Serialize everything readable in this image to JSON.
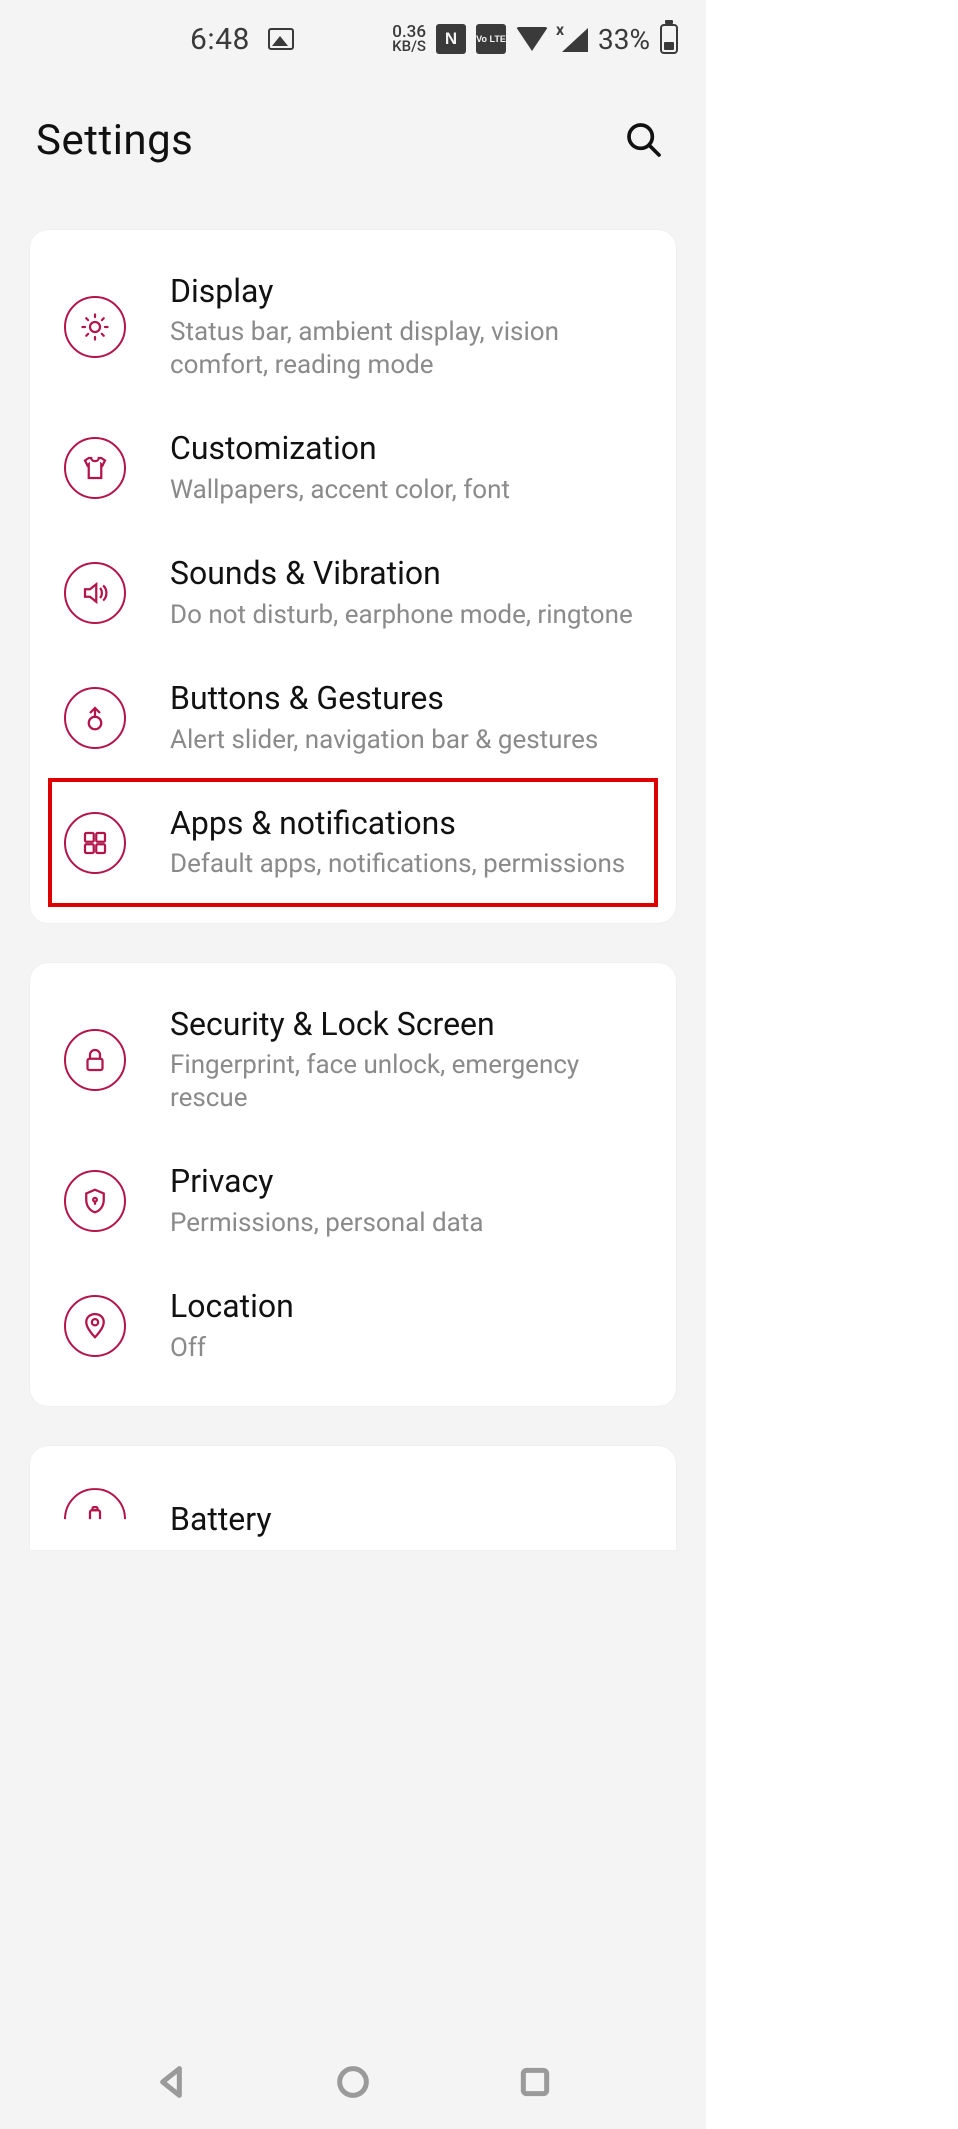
{
  "status": {
    "time": "6:48",
    "net_speed": "0.36",
    "net_unit": "KB/S",
    "nfc": "N",
    "volte": "Vo LTE",
    "sig_x": "x",
    "battery": "33%"
  },
  "header": {
    "title": "Settings"
  },
  "groups": [
    {
      "items": [
        {
          "icon": "brightness",
          "title": "Display",
          "subtitle": "Status bar, ambient display, vision comfort, reading mode",
          "highlighted": false
        },
        {
          "icon": "tshirt",
          "title": "Customization",
          "subtitle": "Wallpapers, accent color, font",
          "highlighted": false
        },
        {
          "icon": "sound",
          "title": "Sounds & Vibration",
          "subtitle": "Do not disturb, earphone mode, ringtone",
          "highlighted": false
        },
        {
          "icon": "gesture",
          "title": "Buttons & Gestures",
          "subtitle": "Alert slider, navigation bar & gestures",
          "highlighted": false
        },
        {
          "icon": "apps",
          "title": "Apps & notifications",
          "subtitle": "Default apps, notifications, permissions",
          "highlighted": true
        }
      ]
    },
    {
      "items": [
        {
          "icon": "lock",
          "title": "Security & Lock Screen",
          "subtitle": "Fingerprint, face unlock, emergency rescue",
          "highlighted": false
        },
        {
          "icon": "shield",
          "title": "Privacy",
          "subtitle": "Permissions, personal data",
          "highlighted": false
        },
        {
          "icon": "location",
          "title": "Location",
          "subtitle": "Off",
          "highlighted": false
        }
      ]
    },
    {
      "items": [
        {
          "icon": "battery",
          "title": "Battery",
          "subtitle": "",
          "highlighted": false
        }
      ]
    }
  ],
  "accent": "#b3154a"
}
